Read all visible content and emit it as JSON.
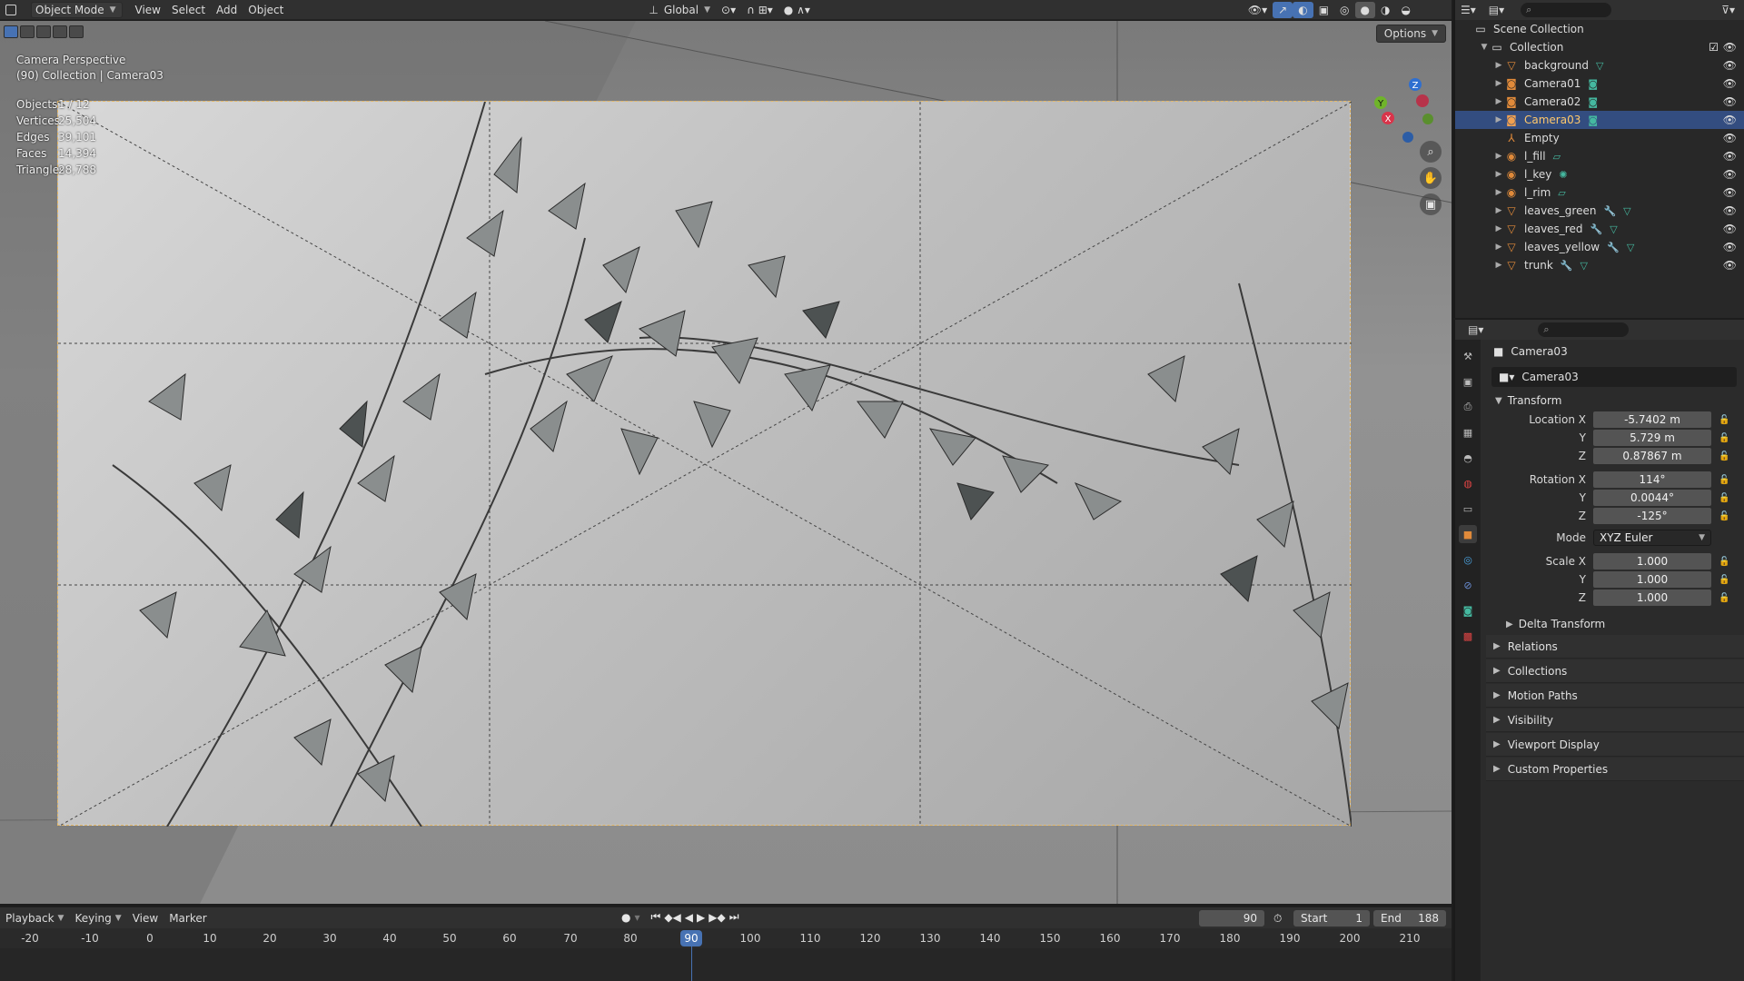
{
  "header": {
    "mode": "Object Mode",
    "menus": [
      "View",
      "Select",
      "Add",
      "Object"
    ],
    "orientation": "Global"
  },
  "viewport": {
    "options_label": "Options",
    "overlay_line1": "Camera Perspective",
    "overlay_line2": "(90) Collection | Camera03",
    "stats": [
      {
        "key": "Objects",
        "value": "1 / 12"
      },
      {
        "key": "Vertices",
        "value": "25,504"
      },
      {
        "key": "Edges",
        "value": "39,101"
      },
      {
        "key": "Faces",
        "value": "14,394"
      },
      {
        "key": "Triangles",
        "value": "28,788"
      }
    ],
    "gizmo": {
      "x": "X",
      "y": "Y",
      "z": "Z"
    }
  },
  "timeline": {
    "menus": [
      "Playback",
      "Keying",
      "View",
      "Marker"
    ],
    "current_frame": "90",
    "start_label": "Start",
    "start_value": "1",
    "end_label": "End",
    "end_value": "188",
    "ticks": [
      "-20",
      "-10",
      "0",
      "10",
      "20",
      "30",
      "40",
      "50",
      "60",
      "70",
      "80",
      "90",
      "100",
      "110",
      "120",
      "130",
      "140",
      "150",
      "160",
      "170",
      "180",
      "190",
      "200",
      "210"
    ]
  },
  "outliner": {
    "scene_collection": "Scene Collection",
    "collection": "Collection",
    "items": [
      {
        "name": "background",
        "type": "mesh",
        "selected": false
      },
      {
        "name": "Camera01",
        "type": "camera",
        "selected": false
      },
      {
        "name": "Camera02",
        "type": "camera",
        "selected": false
      },
      {
        "name": "Camera03",
        "type": "camera",
        "selected": true
      },
      {
        "name": "Empty",
        "type": "empty",
        "selected": false
      },
      {
        "name": "l_fill",
        "type": "light",
        "selected": false
      },
      {
        "name": "l_key",
        "type": "light",
        "selected": false
      },
      {
        "name": "l_rim",
        "type": "light",
        "selected": false
      },
      {
        "name": "leaves_green",
        "type": "mesh",
        "selected": false
      },
      {
        "name": "leaves_red",
        "type": "mesh",
        "selected": false
      },
      {
        "name": "leaves_yellow",
        "type": "mesh",
        "selected": false
      },
      {
        "name": "trunk",
        "type": "mesh",
        "selected": false
      }
    ]
  },
  "properties": {
    "object_title": "Camera03",
    "object_field": "Camera03",
    "transform_label": "Transform",
    "location": {
      "label": "Location X",
      "x": "-5.7402 m",
      "y": "5.729 m",
      "z": "0.87867 m"
    },
    "rotation": {
      "label": "Rotation X",
      "x": "114°",
      "y": "0.0044°",
      "z": "-125°"
    },
    "mode_label": "Mode",
    "mode_value": "XYZ Euler",
    "scale": {
      "label": "Scale X",
      "x": "1.000",
      "y": "1.000",
      "z": "1.000"
    },
    "y_label": "Y",
    "z_label": "Z",
    "delta_transform": "Delta Transform",
    "panels": [
      "Relations",
      "Collections",
      "Motion Paths",
      "Visibility",
      "Viewport Display",
      "Custom Properties"
    ]
  },
  "colors": {
    "accent": "#4772b3",
    "selected_row": "#334d80",
    "camera_frame": "#e3b86a"
  }
}
